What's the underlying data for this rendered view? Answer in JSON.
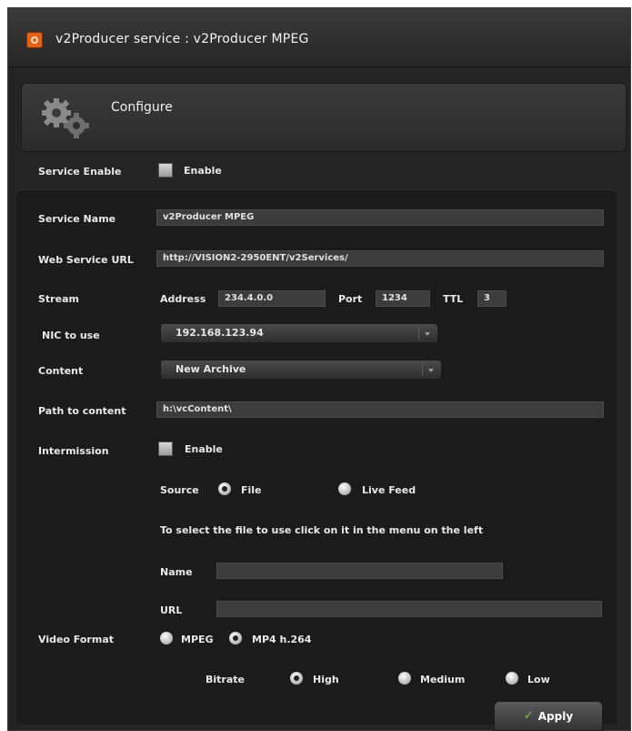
{
  "window": {
    "title": "v2Producer service : v2Producer MPEG"
  },
  "configure": {
    "label": "Configure",
    "icon": "gears-icon"
  },
  "service_enable": {
    "label": "Service Enable",
    "checkbox_label": "Enable",
    "checked": false
  },
  "service_name": {
    "label": "Service Name",
    "value": "v2Producer MPEG"
  },
  "web_service_url": {
    "label": "Web Service URL",
    "value": "http://VISION2-2950ENT/v2Services/"
  },
  "stream": {
    "label": "Stream",
    "address_label": "Address",
    "address_value": "234.4.0.0",
    "port_label": "Port",
    "port_value": "1234",
    "ttl_label": "TTL",
    "ttl_value": "3"
  },
  "nic": {
    "label": "NIC to use",
    "selected": "192.168.123.94"
  },
  "content": {
    "label": "Content",
    "selected": "New Archive"
  },
  "path_to_content": {
    "label": "Path to content",
    "value": "h:\\vcContent\\"
  },
  "intermission": {
    "label": "Intermission",
    "checkbox_label": "Enable",
    "checked": false
  },
  "source": {
    "label": "Source",
    "options": [
      "File",
      "Live Feed"
    ],
    "selected": "File"
  },
  "instruction": "To select the file to use click on it in the menu on the left",
  "file_name": {
    "label": "Name",
    "value": ""
  },
  "file_url": {
    "label": "URL",
    "value": ""
  },
  "video_format": {
    "label": "Video Format",
    "options": [
      "MPEG",
      "MP4 h.264"
    ],
    "selected": "MP4 h.264"
  },
  "bitrate": {
    "label": "Bitrate",
    "options": [
      "High",
      "Medium",
      "Low"
    ],
    "selected": "High"
  },
  "apply_button": {
    "label": "Apply",
    "icon": "check-icon"
  },
  "colors": {
    "background": "#242424",
    "inner_panel": "#1b1b1b",
    "input": "#3c3c3c",
    "accent_orange": "#e0631c",
    "check_green": "#7ccf3b"
  }
}
